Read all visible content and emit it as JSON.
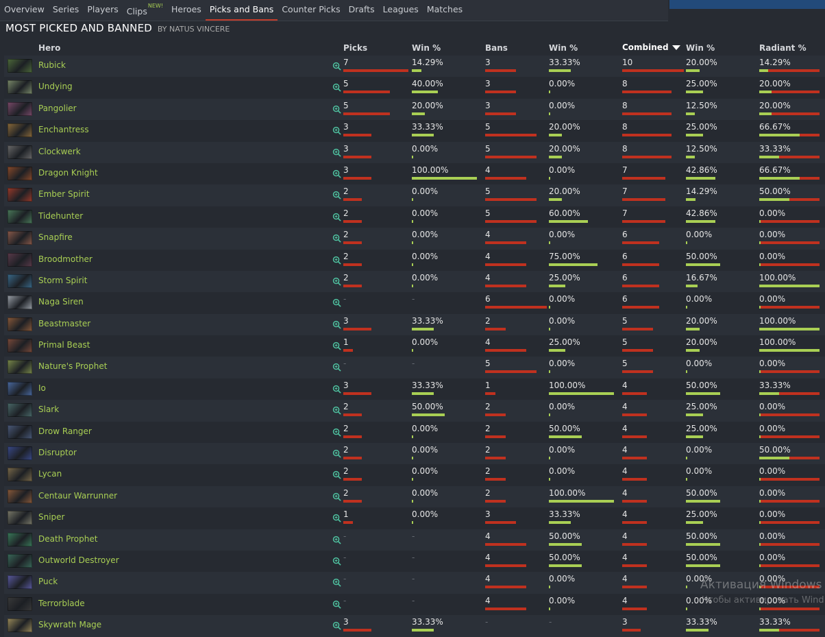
{
  "nav": {
    "tabs": [
      {
        "label": "Overview"
      },
      {
        "label": "Series"
      },
      {
        "label": "Players"
      },
      {
        "label": "Clips",
        "badge": "NEW!"
      },
      {
        "label": "Heroes"
      },
      {
        "label": "Picks and Bans",
        "active": true
      },
      {
        "label": "Counter Picks"
      },
      {
        "label": "Drafts"
      },
      {
        "label": "Leagues"
      },
      {
        "label": "Matches"
      }
    ]
  },
  "page": {
    "title": "MOST PICKED AND BANNED",
    "subtitle": "BY NATUS VINCERE"
  },
  "columns": {
    "hero": "Hero",
    "picks": "Picks",
    "picks_win": "Win %",
    "bans": "Bans",
    "bans_win": "Win %",
    "combined": "Combined",
    "combined_win": "Win %",
    "radiant": "Radiant %"
  },
  "colors": {
    "accent_red": "#c0311f",
    "accent_green": "#a9cf54",
    "hero_link": "#a9cf54"
  },
  "max_values": {
    "picks": 7,
    "bans": 6,
    "combined": 10
  },
  "rows": [
    {
      "hero": "Rubick",
      "picks": "7",
      "picks_win": "14.29%",
      "bans": "3",
      "bans_win": "33.33%",
      "combined": "10",
      "combined_win": "20.00%",
      "radiant": "14.29%"
    },
    {
      "hero": "Undying",
      "picks": "5",
      "picks_win": "40.00%",
      "bans": "3",
      "bans_win": "0.00%",
      "combined": "8",
      "combined_win": "25.00%",
      "radiant": "20.00%"
    },
    {
      "hero": "Pangolier",
      "picks": "5",
      "picks_win": "20.00%",
      "bans": "3",
      "bans_win": "0.00%",
      "combined": "8",
      "combined_win": "12.50%",
      "radiant": "20.00%"
    },
    {
      "hero": "Enchantress",
      "picks": "3",
      "picks_win": "33.33%",
      "bans": "5",
      "bans_win": "20.00%",
      "combined": "8",
      "combined_win": "25.00%",
      "radiant": "66.67%"
    },
    {
      "hero": "Clockwerk",
      "picks": "3",
      "picks_win": "0.00%",
      "bans": "5",
      "bans_win": "20.00%",
      "combined": "8",
      "combined_win": "12.50%",
      "radiant": "33.33%"
    },
    {
      "hero": "Dragon Knight",
      "picks": "3",
      "picks_win": "100.00%",
      "bans": "4",
      "bans_win": "0.00%",
      "combined": "7",
      "combined_win": "42.86%",
      "radiant": "66.67%"
    },
    {
      "hero": "Ember Spirit",
      "picks": "2",
      "picks_win": "0.00%",
      "bans": "5",
      "bans_win": "20.00%",
      "combined": "7",
      "combined_win": "14.29%",
      "radiant": "50.00%"
    },
    {
      "hero": "Tidehunter",
      "picks": "2",
      "picks_win": "0.00%",
      "bans": "5",
      "bans_win": "60.00%",
      "combined": "7",
      "combined_win": "42.86%",
      "radiant": "0.00%"
    },
    {
      "hero": "Snapfire",
      "picks": "2",
      "picks_win": "0.00%",
      "bans": "4",
      "bans_win": "0.00%",
      "combined": "6",
      "combined_win": "0.00%",
      "radiant": "0.00%"
    },
    {
      "hero": "Broodmother",
      "picks": "2",
      "picks_win": "0.00%",
      "bans": "4",
      "bans_win": "75.00%",
      "combined": "6",
      "combined_win": "50.00%",
      "radiant": "0.00%"
    },
    {
      "hero": "Storm Spirit",
      "picks": "2",
      "picks_win": "0.00%",
      "bans": "4",
      "bans_win": "25.00%",
      "combined": "6",
      "combined_win": "16.67%",
      "radiant": "100.00%"
    },
    {
      "hero": "Naga Siren",
      "picks": "-",
      "picks_win": "-",
      "bans": "6",
      "bans_win": "0.00%",
      "combined": "6",
      "combined_win": "0.00%",
      "radiant": "0.00%"
    },
    {
      "hero": "Beastmaster",
      "picks": "3",
      "picks_win": "33.33%",
      "bans": "2",
      "bans_win": "0.00%",
      "combined": "5",
      "combined_win": "20.00%",
      "radiant": "100.00%"
    },
    {
      "hero": "Primal Beast",
      "picks": "1",
      "picks_win": "0.00%",
      "bans": "4",
      "bans_win": "25.00%",
      "combined": "5",
      "combined_win": "20.00%",
      "radiant": "100.00%"
    },
    {
      "hero": "Nature's Prophet",
      "picks": "-",
      "picks_win": "-",
      "bans": "5",
      "bans_win": "0.00%",
      "combined": "5",
      "combined_win": "0.00%",
      "radiant": "0.00%"
    },
    {
      "hero": "Io",
      "picks": "3",
      "picks_win": "33.33%",
      "bans": "1",
      "bans_win": "100.00%",
      "combined": "4",
      "combined_win": "50.00%",
      "radiant": "33.33%"
    },
    {
      "hero": "Slark",
      "picks": "2",
      "picks_win": "50.00%",
      "bans": "2",
      "bans_win": "0.00%",
      "combined": "4",
      "combined_win": "25.00%",
      "radiant": "0.00%"
    },
    {
      "hero": "Drow Ranger",
      "picks": "2",
      "picks_win": "0.00%",
      "bans": "2",
      "bans_win": "50.00%",
      "combined": "4",
      "combined_win": "25.00%",
      "radiant": "0.00%"
    },
    {
      "hero": "Disruptor",
      "picks": "2",
      "picks_win": "0.00%",
      "bans": "2",
      "bans_win": "0.00%",
      "combined": "4",
      "combined_win": "0.00%",
      "radiant": "50.00%"
    },
    {
      "hero": "Lycan",
      "picks": "2",
      "picks_win": "0.00%",
      "bans": "2",
      "bans_win": "0.00%",
      "combined": "4",
      "combined_win": "0.00%",
      "radiant": "0.00%"
    },
    {
      "hero": "Centaur Warrunner",
      "picks": "2",
      "picks_win": "0.00%",
      "bans": "2",
      "bans_win": "100.00%",
      "combined": "4",
      "combined_win": "50.00%",
      "radiant": "0.00%"
    },
    {
      "hero": "Sniper",
      "picks": "1",
      "picks_win": "0.00%",
      "bans": "3",
      "bans_win": "33.33%",
      "combined": "4",
      "combined_win": "25.00%",
      "radiant": "0.00%"
    },
    {
      "hero": "Death Prophet",
      "picks": "-",
      "picks_win": "-",
      "bans": "4",
      "bans_win": "50.00%",
      "combined": "4",
      "combined_win": "50.00%",
      "radiant": "0.00%"
    },
    {
      "hero": "Outworld Destroyer",
      "picks": "-",
      "picks_win": "-",
      "bans": "4",
      "bans_win": "50.00%",
      "combined": "4",
      "combined_win": "50.00%",
      "radiant": "0.00%"
    },
    {
      "hero": "Puck",
      "picks": "-",
      "picks_win": "-",
      "bans": "4",
      "bans_win": "0.00%",
      "combined": "4",
      "combined_win": "0.00%",
      "radiant": "0.00%"
    },
    {
      "hero": "Terrorblade",
      "picks": "-",
      "picks_win": "-",
      "bans": "4",
      "bans_win": "0.00%",
      "combined": "4",
      "combined_win": "0.00%",
      "radiant": "0.00%"
    },
    {
      "hero": "Skywrath Mage",
      "picks": "3",
      "picks_win": "33.33%",
      "bans": "-",
      "bans_win": "-",
      "combined": "3",
      "combined_win": "33.33%",
      "radiant": "33.33%"
    }
  ],
  "portrait_colors": [
    "#4d6a3a",
    "#7a8a6a",
    "#7a4a6a",
    "#8a6a3a",
    "#6a6a6a",
    "#8a4a2a",
    "#9a3a2a",
    "#4a7a5a",
    "#8a5a4a",
    "#5a3a4a",
    "#3a6a8a",
    "#9aa0a8",
    "#8a5a3a",
    "#7a4a3a",
    "#7a8a4a",
    "#4a6aa0",
    "#4a6a6a",
    "#4a5a7a",
    "#3a4a8a",
    "#7a6a4a",
    "#8a5a3a",
    "#7a7a6a",
    "#3a7a5a",
    "#3a6a5a",
    "#5a5aa0",
    "#3a3a3a",
    "#9a8a5a"
  ],
  "watermark": {
    "line1": "Активация Windows",
    "line2": "Чтобы активировать Wind"
  }
}
